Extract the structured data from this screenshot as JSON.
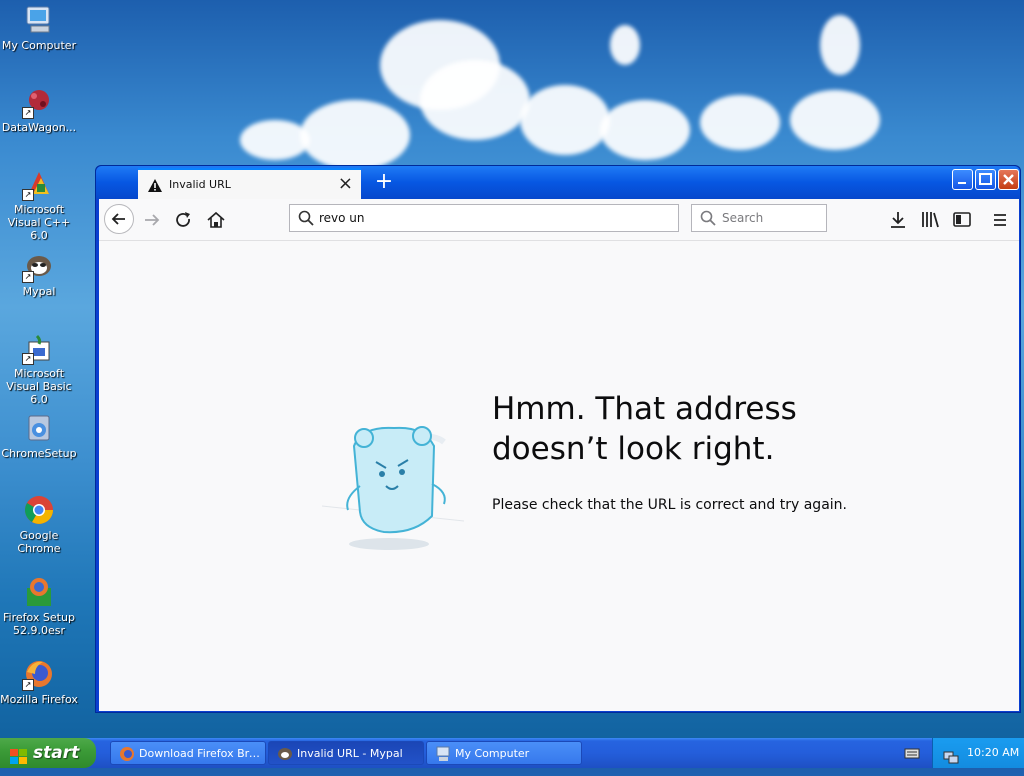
{
  "desktop": {
    "icons": [
      {
        "label": "My Computer",
        "icon": "my-computer-icon"
      },
      {
        "label": "DataWagon...",
        "icon": "datawagon-icon"
      },
      {
        "label": "Microsoft Visual C++ 6.0",
        "icon": "visual-cpp-icon"
      },
      {
        "label": "Mypal",
        "icon": "mypal-icon"
      },
      {
        "label": "Microsoft Visual Basic 6.0",
        "icon": "visual-basic-icon"
      },
      {
        "label": "ChromeSetup",
        "icon": "chrome-setup-icon"
      },
      {
        "label": "Google Chrome",
        "icon": "google-chrome-icon"
      },
      {
        "label": "Firefox Setup 52.9.0esr",
        "icon": "firefox-setup-icon"
      },
      {
        "label": "Mozilla Firefox",
        "icon": "firefox-icon"
      }
    ]
  },
  "browser": {
    "tab": {
      "title": "Invalid URL",
      "icon": "warning-icon"
    },
    "url_value": "revo un",
    "search_placeholder": "Search",
    "error": {
      "title": "Hmm. That address doesn’t look right.",
      "description": "Please check that the URL is correct and try again."
    }
  },
  "taskbar": {
    "start_label": "start",
    "tasks": [
      {
        "label": "Download Firefox Bro...",
        "icon": "firefox-icon",
        "active": false
      },
      {
        "label": "Invalid URL - Mypal",
        "icon": "mypal-icon",
        "active": true
      },
      {
        "label": "My Computer",
        "icon": "my-computer-icon",
        "active": false
      }
    ],
    "clock": "10:20 AM"
  },
  "colors": {
    "titlebar_blue": "#0757e2",
    "start_green": "#3c9c38",
    "tab_accent": "#0a84ff",
    "close_red": "#c43d13"
  }
}
